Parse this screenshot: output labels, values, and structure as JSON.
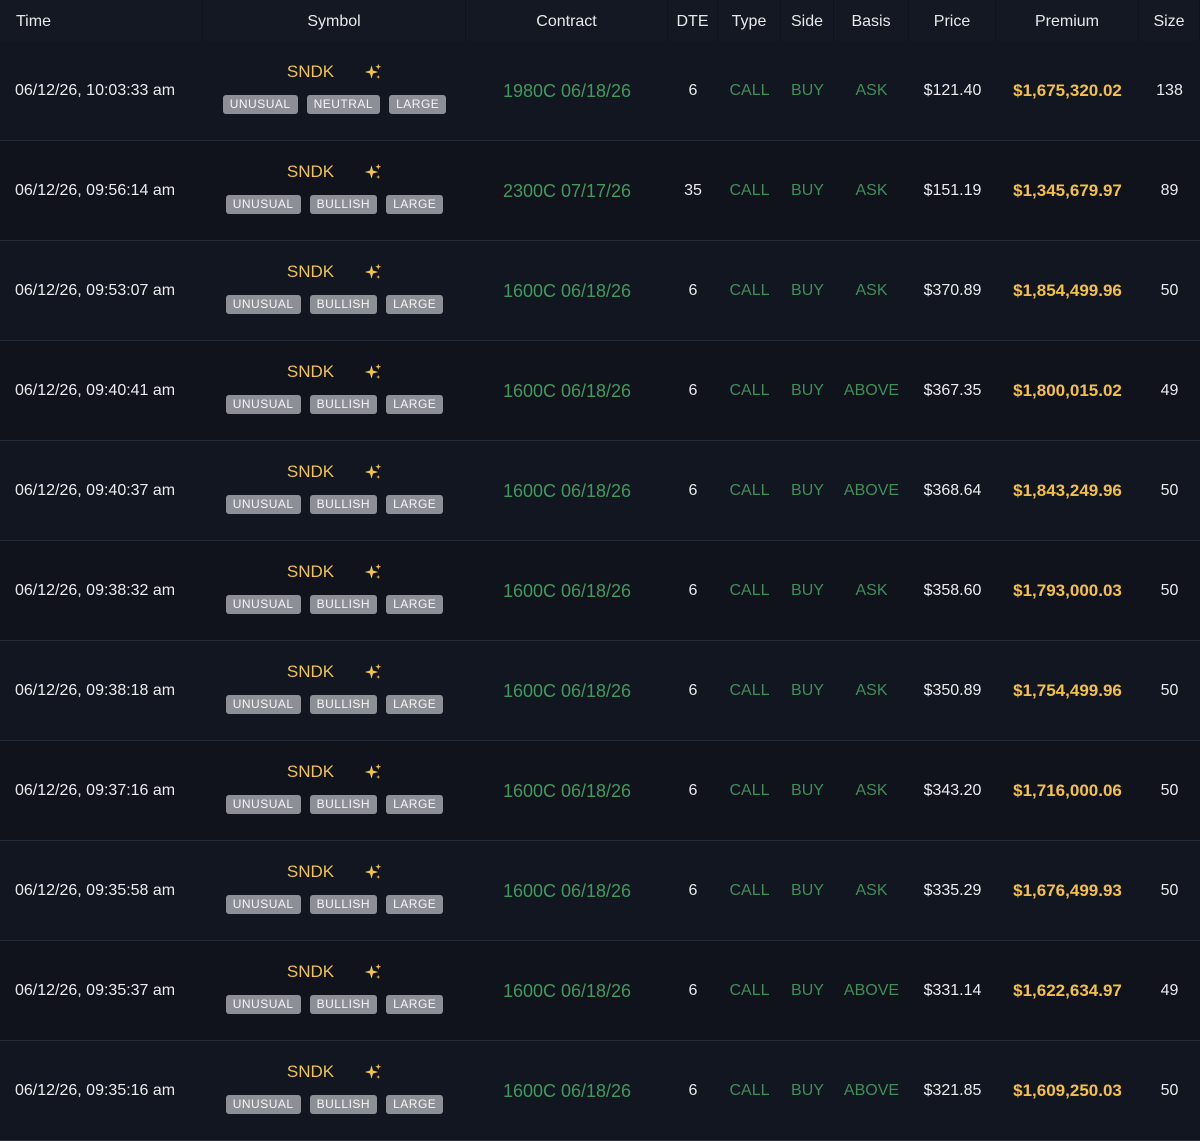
{
  "columns": {
    "time": "Time",
    "symbol": "Symbol",
    "contract": "Contract",
    "dte": "DTE",
    "type": "Type",
    "side": "Side",
    "basis": "Basis",
    "price": "Price",
    "premium": "Premium",
    "size": "Size"
  },
  "icons": {
    "ai_insight": "sparkle-icon"
  },
  "colors": {
    "background": "#10131b",
    "ticker": "#f2c544",
    "premium": "#f3c13d",
    "call_buy_green": "#3d8f58",
    "contract_green": "#3f9a5c",
    "tag_background": "#8c8f96"
  },
  "rows": [
    {
      "time": "06/12/26, 10:03:33 am",
      "symbol": "SNDK",
      "tags": [
        "UNUSUAL",
        "NEUTRAL",
        "LARGE"
      ],
      "contract": "1980C 06/18/26",
      "dte": "6",
      "type": "CALL",
      "side": "BUY",
      "basis": "ASK",
      "price": "$121.40",
      "premium": "$1,675,320.02",
      "size": "138"
    },
    {
      "time": "06/12/26, 09:56:14 am",
      "symbol": "SNDK",
      "tags": [
        "UNUSUAL",
        "BULLISH",
        "LARGE"
      ],
      "contract": "2300C 07/17/26",
      "dte": "35",
      "type": "CALL",
      "side": "BUY",
      "basis": "ASK",
      "price": "$151.19",
      "premium": "$1,345,679.97",
      "size": "89"
    },
    {
      "time": "06/12/26, 09:53:07 am",
      "symbol": "SNDK",
      "tags": [
        "UNUSUAL",
        "BULLISH",
        "LARGE"
      ],
      "contract": "1600C 06/18/26",
      "dte": "6",
      "type": "CALL",
      "side": "BUY",
      "basis": "ASK",
      "price": "$370.89",
      "premium": "$1,854,499.96",
      "size": "50"
    },
    {
      "time": "06/12/26, 09:40:41 am",
      "symbol": "SNDK",
      "tags": [
        "UNUSUAL",
        "BULLISH",
        "LARGE"
      ],
      "contract": "1600C 06/18/26",
      "dte": "6",
      "type": "CALL",
      "side": "BUY",
      "basis": "ABOVE",
      "price": "$367.35",
      "premium": "$1,800,015.02",
      "size": "49"
    },
    {
      "time": "06/12/26, 09:40:37 am",
      "symbol": "SNDK",
      "tags": [
        "UNUSUAL",
        "BULLISH",
        "LARGE"
      ],
      "contract": "1600C 06/18/26",
      "dte": "6",
      "type": "CALL",
      "side": "BUY",
      "basis": "ABOVE",
      "price": "$368.64",
      "premium": "$1,843,249.96",
      "size": "50"
    },
    {
      "time": "06/12/26, 09:38:32 am",
      "symbol": "SNDK",
      "tags": [
        "UNUSUAL",
        "BULLISH",
        "LARGE"
      ],
      "contract": "1600C 06/18/26",
      "dte": "6",
      "type": "CALL",
      "side": "BUY",
      "basis": "ASK",
      "price": "$358.60",
      "premium": "$1,793,000.03",
      "size": "50"
    },
    {
      "time": "06/12/26, 09:38:18 am",
      "symbol": "SNDK",
      "tags": [
        "UNUSUAL",
        "BULLISH",
        "LARGE"
      ],
      "contract": "1600C 06/18/26",
      "dte": "6",
      "type": "CALL",
      "side": "BUY",
      "basis": "ASK",
      "price": "$350.89",
      "premium": "$1,754,499.96",
      "size": "50"
    },
    {
      "time": "06/12/26, 09:37:16 am",
      "symbol": "SNDK",
      "tags": [
        "UNUSUAL",
        "BULLISH",
        "LARGE"
      ],
      "contract": "1600C 06/18/26",
      "dte": "6",
      "type": "CALL",
      "side": "BUY",
      "basis": "ASK",
      "price": "$343.20",
      "premium": "$1,716,000.06",
      "size": "50"
    },
    {
      "time": "06/12/26, 09:35:58 am",
      "symbol": "SNDK",
      "tags": [
        "UNUSUAL",
        "BULLISH",
        "LARGE"
      ],
      "contract": "1600C 06/18/26",
      "dte": "6",
      "type": "CALL",
      "side": "BUY",
      "basis": "ASK",
      "price": "$335.29",
      "premium": "$1,676,499.93",
      "size": "50"
    },
    {
      "time": "06/12/26, 09:35:37 am",
      "symbol": "SNDK",
      "tags": [
        "UNUSUAL",
        "BULLISH",
        "LARGE"
      ],
      "contract": "1600C 06/18/26",
      "dte": "6",
      "type": "CALL",
      "side": "BUY",
      "basis": "ABOVE",
      "price": "$331.14",
      "premium": "$1,622,634.97",
      "size": "49"
    },
    {
      "time": "06/12/26, 09:35:16 am",
      "symbol": "SNDK",
      "tags": [
        "UNUSUAL",
        "BULLISH",
        "LARGE"
      ],
      "contract": "1600C 06/18/26",
      "dte": "6",
      "type": "CALL",
      "side": "BUY",
      "basis": "ABOVE",
      "price": "$321.85",
      "premium": "$1,609,250.03",
      "size": "50"
    }
  ]
}
